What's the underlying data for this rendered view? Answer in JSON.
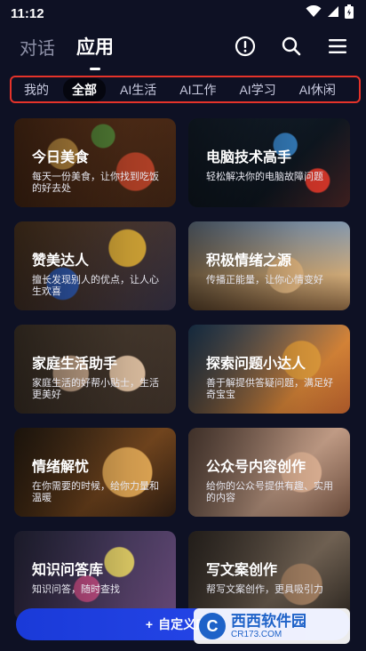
{
  "status": {
    "time": "11:12"
  },
  "header": {
    "tabs": [
      {
        "label": "对话",
        "active": false
      },
      {
        "label": "应用",
        "active": true
      }
    ],
    "icons": [
      "alert-icon",
      "search-icon",
      "menu-icon"
    ]
  },
  "categories": [
    {
      "label": "我的",
      "active": false
    },
    {
      "label": "全部",
      "active": true
    },
    {
      "label": "AI生活",
      "active": false
    },
    {
      "label": "AI工作",
      "active": false
    },
    {
      "label": "AI学习",
      "active": false
    },
    {
      "label": "AI休闲",
      "active": false
    }
  ],
  "cards": [
    {
      "title": "今日美食",
      "desc": "每天一份美食，让你找到吃饭的好去处"
    },
    {
      "title": "电脑技术高手",
      "desc": "轻松解决你的电脑故障问题"
    },
    {
      "title": "赞美达人",
      "desc": "擅长发现别人的优点，让人心生欢喜"
    },
    {
      "title": "积极情绪之源",
      "desc": "传播正能量，让你心情变好"
    },
    {
      "title": "家庭生活助手",
      "desc": "家庭生活的好帮小贴士，生活更美好"
    },
    {
      "title": "探索问题小达人",
      "desc": "善于解提供答疑问题，满足好奇宝宝"
    },
    {
      "title": "情绪解忧",
      "desc": "在你需要的时候，给你力量和温暖"
    },
    {
      "title": "公众号内容创作",
      "desc": "给你的公众号提供有趣、实用的内容"
    },
    {
      "title": "知识问答库",
      "desc": "知识问答，随时查找"
    },
    {
      "title": "写文案创作",
      "desc": "帮写文案创作，更具吸引力"
    }
  ],
  "bottom_button": {
    "plus": "+",
    "label": "自定义应用"
  },
  "watermark": {
    "logo": "C",
    "title": "西西软件园",
    "url": "CR173.COM"
  }
}
